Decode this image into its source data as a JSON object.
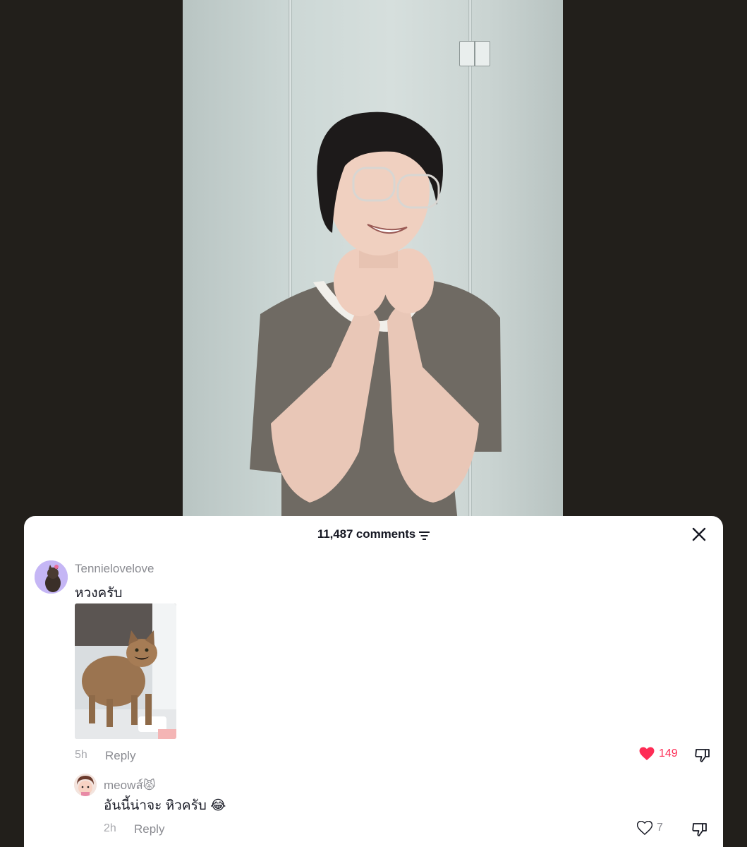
{
  "video": {
    "description_icon": "person-video-frame"
  },
  "comments_sheet": {
    "count_label": "11,487 comments",
    "sort_icon": "sort-lines-icon",
    "close_icon": "close-icon",
    "comments": [
      {
        "username": "Tennielovelove",
        "text": "หวงครับ",
        "attachment": "cat-with-mustache-photo",
        "time": "5h",
        "reply_label": "Reply",
        "likes": "149",
        "liked": true
      }
    ],
    "replies": [
      {
        "username": "meowส์😾",
        "text": "อันนี้น่าจะ หิวครับ 😂",
        "time": "2h",
        "reply_label": "Reply",
        "likes": "7",
        "liked": false
      }
    ]
  },
  "colors": {
    "like_red": "#fe2c55",
    "sheet_bg": "#ffffff",
    "page_bg": "#221f1b"
  }
}
